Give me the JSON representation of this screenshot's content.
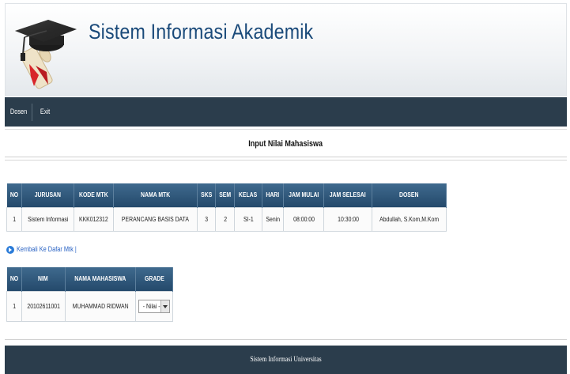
{
  "header": {
    "app_title": "Sistem Informasi Akademik"
  },
  "nav": {
    "items": [
      {
        "label": "Dosen"
      },
      {
        "label": "Exit"
      }
    ]
  },
  "page": {
    "title": "Input Nilai Mahasiswa"
  },
  "course_table": {
    "headers": [
      "NO",
      "JURUSAN",
      "KODE MTK",
      "NAMA MTK",
      "SKS",
      "SEM",
      "KELAS",
      "HARI",
      "JAM MULAI",
      "JAM SELESAI",
      "DOSEN"
    ],
    "rows": [
      [
        "1",
        "Sistem Informasi",
        "KKK012312",
        "PERANCANG BASIS DATA",
        "3",
        "2",
        "SI-1",
        "Senin",
        "08:00:00",
        "10:30:00",
        "Abdullah, S.Kom,M.Kom"
      ]
    ]
  },
  "back_link": {
    "label": "Kembali Ke Dafar Mtk |"
  },
  "student_table": {
    "headers": [
      "NO",
      "NIM",
      "NAMA MAHASISWA",
      "GRADE"
    ],
    "rows": [
      {
        "no": "1",
        "nim": "20102611001",
        "name": "MUHAMMAD RIDWAN",
        "grade_value": "- Nilai -"
      }
    ]
  },
  "footer": {
    "text": "Sistem Informasi Universitas"
  },
  "colors": {
    "navbar": "#2b3d4c",
    "table_header": "#2f5678",
    "link": "#2a63c4"
  }
}
